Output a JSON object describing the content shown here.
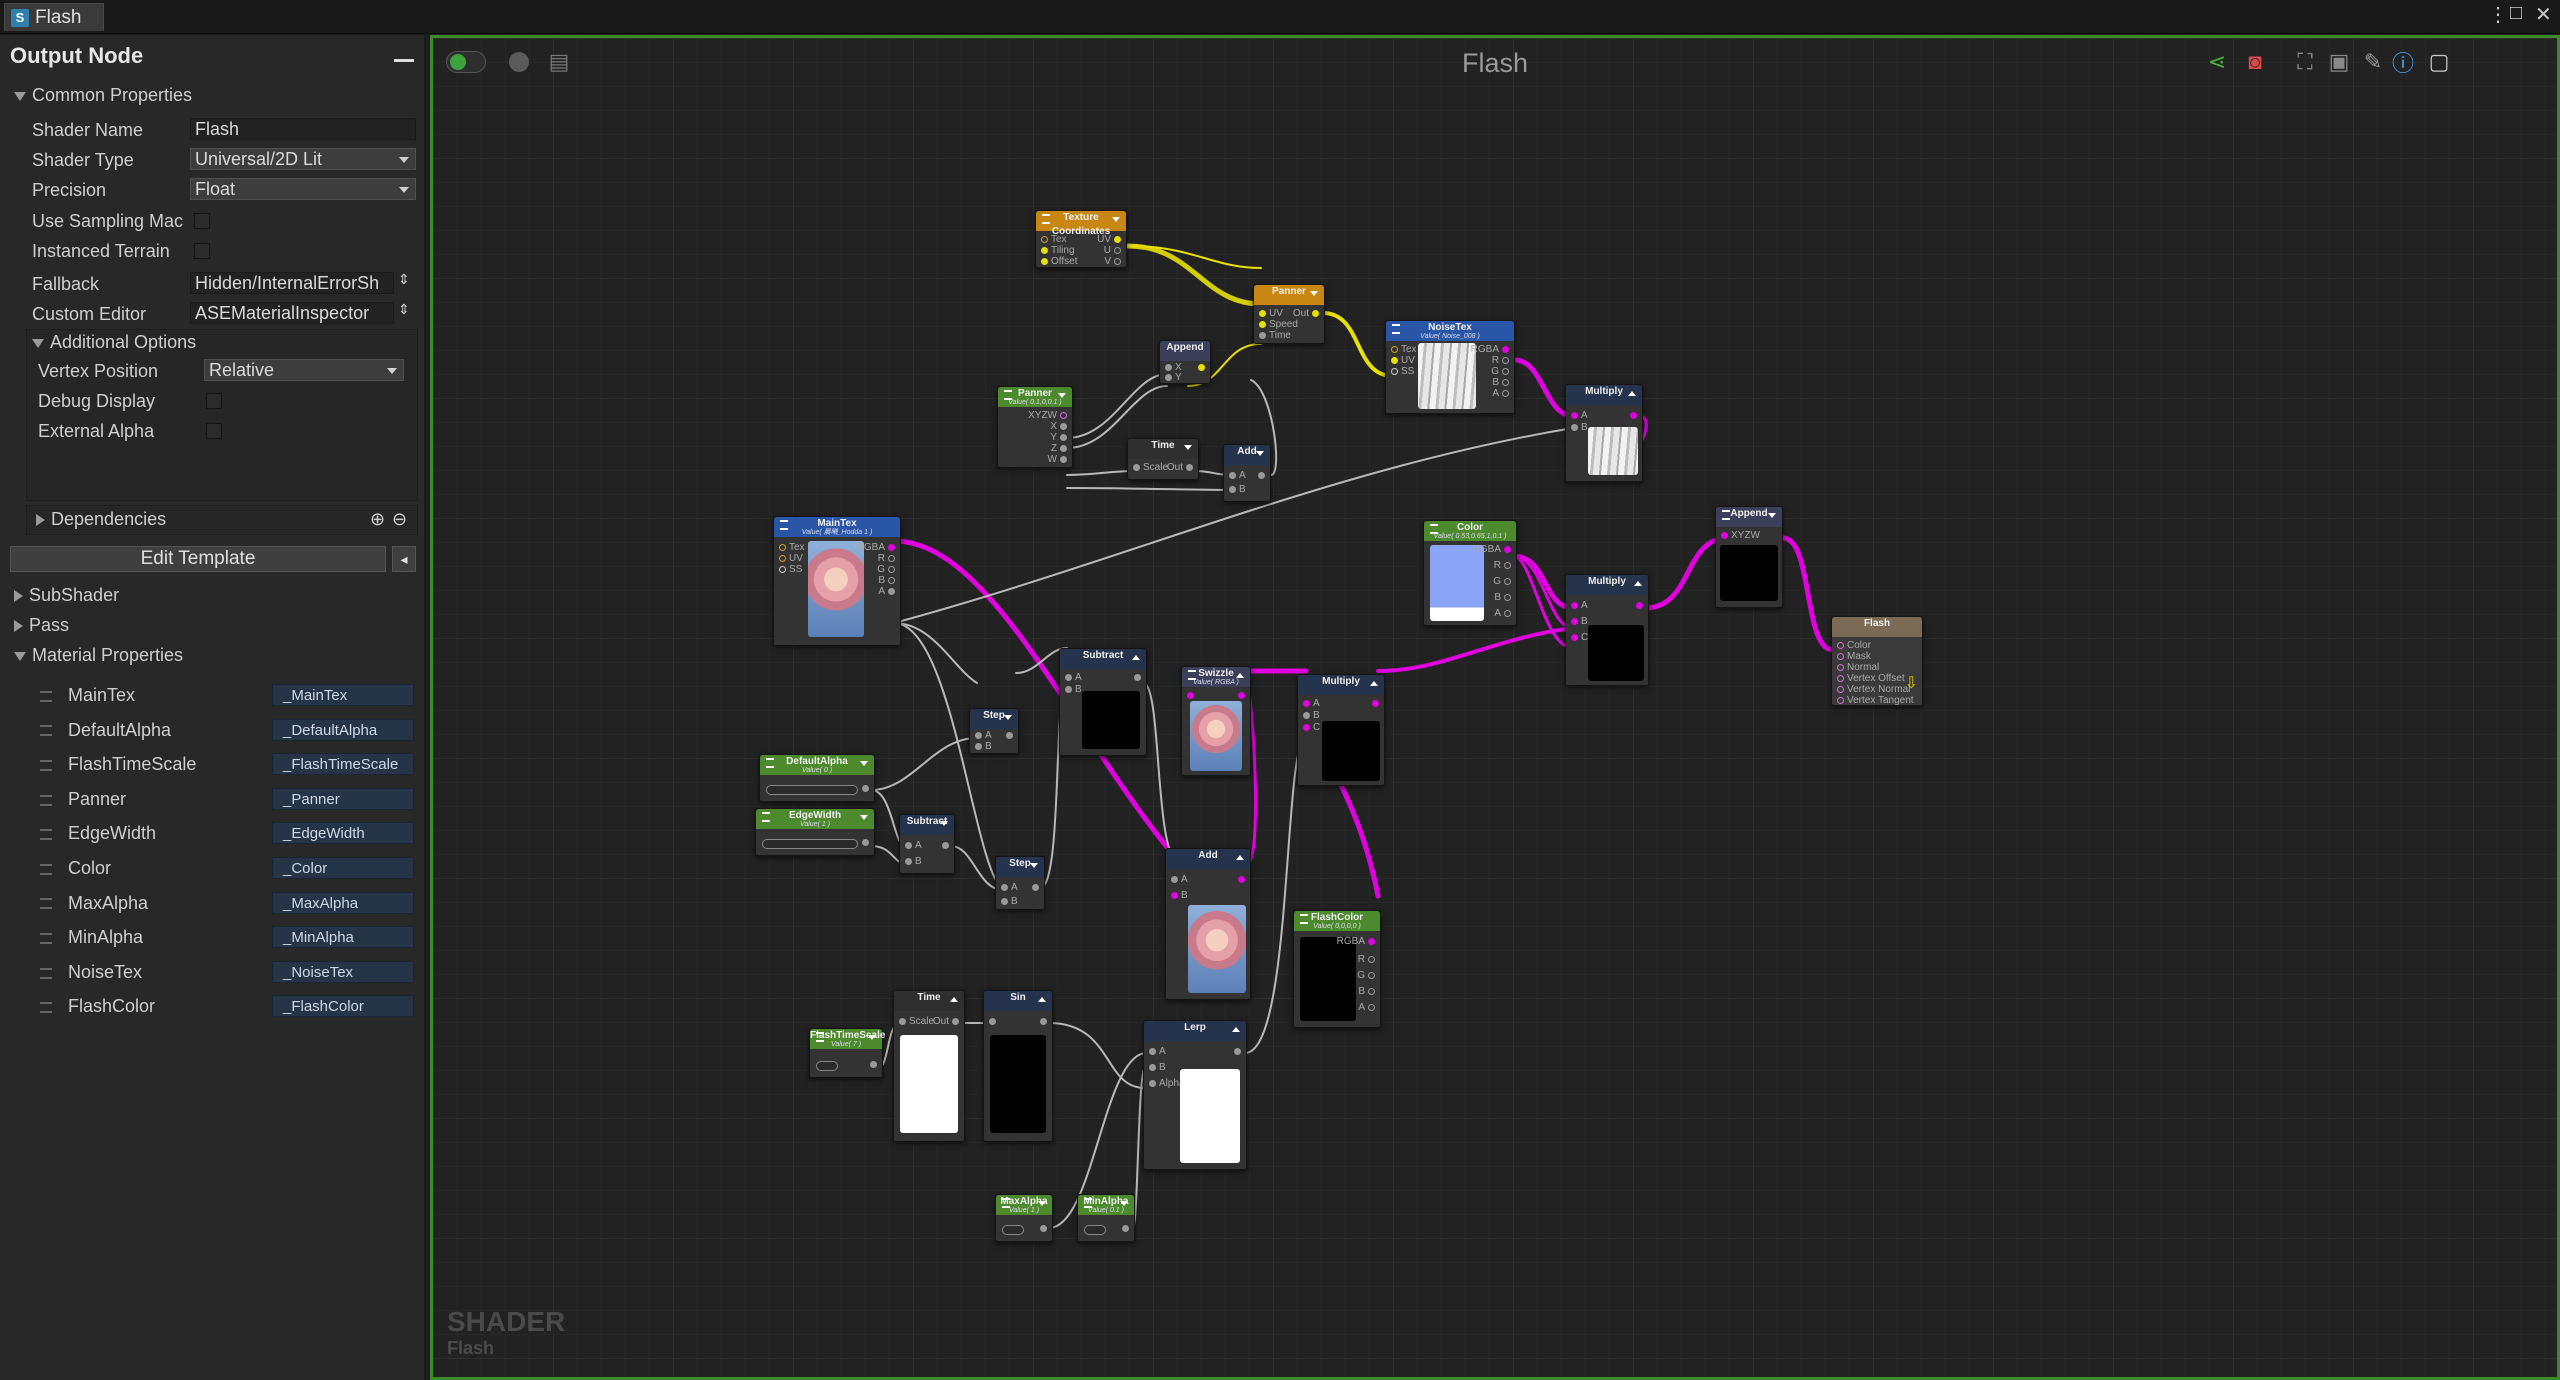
{
  "window": {
    "tab_label": "Flash",
    "canvas_title": "Flash",
    "watermark_title": "SHADER",
    "watermark_sub": "Flash"
  },
  "sidebar": {
    "title": "Output Node",
    "common_header": "Common Properties",
    "shader_name_label": "Shader Name",
    "shader_name_value": "Flash",
    "shader_type_label": "Shader Type",
    "shader_type_value": "Universal/2D Lit",
    "precision_label": "Precision",
    "precision_value": "Float",
    "use_sampling_label": "Use Sampling Mac",
    "instanced_terrain_label": "Instanced Terrain",
    "fallback_label": "Fallback",
    "fallback_value": "Hidden/InternalErrorSh",
    "custom_editor_label": "Custom Editor",
    "custom_editor_value": "ASEMaterialInspector",
    "additional_header": "Additional Options",
    "vertex_position_label": "Vertex Position",
    "vertex_position_value": "Relative",
    "debug_display_label": "Debug Display",
    "external_alpha_label": "External Alpha",
    "dependencies_label": "Dependencies",
    "edit_template_label": "Edit Template",
    "subshader_label": "SubShader",
    "pass_label": "Pass",
    "material_properties_label": "Material Properties",
    "properties": [
      {
        "name": "MainTex",
        "value": "_MainTex"
      },
      {
        "name": "DefaultAlpha",
        "value": "_DefaultAlpha"
      },
      {
        "name": "FlashTimeScale",
        "value": "_FlashTimeScale"
      },
      {
        "name": "Panner",
        "value": "_Panner"
      },
      {
        "name": "EdgeWidth",
        "value": "_EdgeWidth"
      },
      {
        "name": "Color",
        "value": "_Color"
      },
      {
        "name": "MaxAlpha",
        "value": "_MaxAlpha"
      },
      {
        "name": "MinAlpha",
        "value": "_MinAlpha"
      },
      {
        "name": "NoiseTex",
        "value": "_NoiseTex"
      },
      {
        "name": "FlashColor",
        "value": "_FlashColor"
      }
    ]
  },
  "nodes": {
    "texcoords": {
      "title": "Texture Coordinates",
      "p_tex": "Tex",
      "p_tiling": "Tiling",
      "p_offset": "Offset",
      "o_uv": "UV",
      "o_u": "U",
      "o_v": "V"
    },
    "panner_top": {
      "title": "Panner",
      "p_uv": "UV",
      "p_speed": "Speed",
      "p_time": "Time",
      "o_out": "Out"
    },
    "noisetex": {
      "title": "NoiseTex",
      "sub": "Value( Noise_008 )",
      "p_tex": "Tex",
      "p_uv": "UV",
      "p_ss": "SS",
      "o_rgba": "RGBA",
      "o_r": "R",
      "o_g": "G",
      "o_b": "B",
      "o_a": "A"
    },
    "append_small": {
      "title": "Append",
      "p_x": "X",
      "p_y": "Y"
    },
    "panner_prop": {
      "title": "Panner",
      "sub": "Value( 0,1,0,0.1 )",
      "o_xyzw": "XYZW",
      "o_x": "X",
      "o_y": "Y",
      "o_z": "Z",
      "o_w": "W"
    },
    "time_top": {
      "title": "Time",
      "p_scale": "Scale",
      "o_out": "Out"
    },
    "add_small": {
      "title": "Add",
      "p_a": "A",
      "p_b": "B"
    },
    "multiply_noise": {
      "title": "Multiply",
      "p_a": "A",
      "p_b": "B"
    },
    "maintex": {
      "title": "MainTex",
      "sub": "Value( 晨曦_Hodda 1 )",
      "p_tex": "Tex",
      "p_uv": "UV",
      "p_ss": "SS",
      "o_rgba": "RGBA",
      "o_r": "R",
      "o_g": "G",
      "o_b": "B",
      "o_a": "A"
    },
    "color": {
      "title": "Color",
      "sub": "Value( 0.53,0.65,1,0.1 )",
      "o_rgba": "RGBA",
      "o_r": "R",
      "o_g": "G",
      "o_b": "B",
      "o_a": "A"
    },
    "append_big": {
      "title": "Append",
      "o_xyzw": "XYZW"
    },
    "multiply_color": {
      "title": "Multiply",
      "p_a": "A",
      "p_b": "B",
      "p_c": "C"
    },
    "output": {
      "title": "Flash",
      "p_color": "Color",
      "p_mask": "Mask",
      "p_normal": "Normal",
      "p_voffset": "Vertex Offset",
      "p_vnormal": "Vertex Normal",
      "p_vtangent": "Vertex Tangent"
    },
    "subtract_top": {
      "title": "Subtract",
      "p_a": "A",
      "p_b": "B"
    },
    "step_top": {
      "title": "Step",
      "p_a": "A",
      "p_b": "B"
    },
    "swizzle": {
      "title": "Swizzle",
      "sub": "Value( RGBA )"
    },
    "multiply_mid": {
      "title": "Multiply",
      "p_a": "A",
      "p_b": "B",
      "p_c": "C"
    },
    "defaultalpha": {
      "title": "DefaultAlpha",
      "sub": "Value( 0 )"
    },
    "subtract_small": {
      "title": "Subtract",
      "p_a": "A",
      "p_b": "B"
    },
    "edgewidth": {
      "title": "EdgeWidth",
      "sub": "Value( 1 )"
    },
    "step_bottom": {
      "title": "Step",
      "p_a": "A",
      "p_b": "B"
    },
    "add_big": {
      "title": "Add",
      "p_a": "A",
      "p_b": "B"
    },
    "flashcolor": {
      "title": "FlashColor",
      "sub": "Value( 0,0,0,0 )",
      "o_rgba": "RGBA",
      "o_r": "R",
      "o_g": "G",
      "o_b": "B",
      "o_a": "A"
    },
    "time_bottom": {
      "title": "Time",
      "p_scale": "Scale",
      "o_out": "Out"
    },
    "sin": {
      "title": "Sin"
    },
    "flashtimescale": {
      "title": "FlashTimeScale",
      "sub": "Value( 7 )"
    },
    "lerp": {
      "title": "Lerp",
      "p_a": "A",
      "p_b": "B",
      "p_alpha": "Alpha"
    },
    "maxalpha": {
      "title": "MaxAlpha",
      "sub": "Value( 1 )"
    },
    "minalpha": {
      "title": "MinAlpha",
      "sub": "Value( 0.1 )"
    }
  },
  "colors": {
    "accent_green": "#3c8a2a",
    "wire_magenta": "#e000e0",
    "wire_yellow": "#e8e000",
    "wire_gray": "#b0b0b0"
  }
}
